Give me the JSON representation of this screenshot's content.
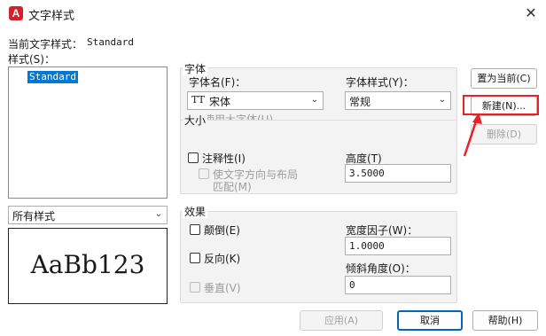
{
  "window": {
    "title": "文字样式",
    "app_icon": "autocad-a-icon",
    "close_glyph": "✕"
  },
  "current_style": {
    "label": "当前文字样式：",
    "value": "Standard"
  },
  "styles": {
    "label": "样式(S)：",
    "items": [
      "Standard"
    ],
    "selected": "Standard"
  },
  "filter": {
    "value": "所有样式"
  },
  "preview": {
    "text": "AaBb123"
  },
  "font_group": {
    "label": "字体",
    "font_name_label": "字体名(F)：",
    "font_name_value": "宋体",
    "font_icon": "truetype-icon",
    "font_style_label": "字体样式(Y)：",
    "font_style_value": "常规",
    "use_big_font_label": "使用大字体(U)"
  },
  "size_group": {
    "label": "大小",
    "annotative_label": "注释性(I)",
    "match_orientation_label_1": "使文字方向与布局",
    "match_orientation_label_2": "匹配(M)",
    "height_label": "高度(T)",
    "height_value": "3.5000"
  },
  "effects_group": {
    "label": "效果",
    "upside_down_label": "颠倒(E)",
    "backwards_label": "反向(K)",
    "vertical_label": "垂直(V)",
    "width_factor_label": "宽度因子(W)：",
    "width_factor_value": "1.0000",
    "oblique_label": "倾斜角度(O)：",
    "oblique_value": "0"
  },
  "buttons": {
    "set_current": "置为当前(C)",
    "new": "新建(N)...",
    "delete": "删除(D)",
    "apply": "应用(A)",
    "cancel": "取消",
    "help": "帮助(H)"
  },
  "colors": {
    "accent": "#0078d7",
    "highlight": "#e8212b",
    "brand": "#d6202a"
  }
}
